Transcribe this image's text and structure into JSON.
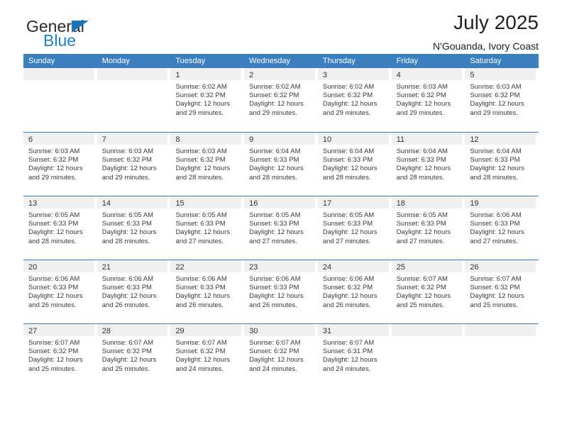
{
  "brand": {
    "name_top": "General",
    "name_bottom": "Blue"
  },
  "header": {
    "title": "July 2025",
    "subtitle": "N'Gouanda, Ivory Coast"
  },
  "calendar": {
    "weekdays": [
      "Sunday",
      "Monday",
      "Tuesday",
      "Wednesday",
      "Thursday",
      "Friday",
      "Saturday"
    ],
    "accent_color": "#3c7fbe",
    "band_color": "#f0f0f0",
    "weeks": [
      [
        {
          "day": "",
          "empty": true
        },
        {
          "day": "",
          "empty": true
        },
        {
          "day": "1",
          "sunrise": "Sunrise: 6:02 AM",
          "sunset": "Sunset: 6:32 PM",
          "daylight1": "Daylight: 12 hours",
          "daylight2": "and 29 minutes."
        },
        {
          "day": "2",
          "sunrise": "Sunrise: 6:02 AM",
          "sunset": "Sunset: 6:32 PM",
          "daylight1": "Daylight: 12 hours",
          "daylight2": "and 29 minutes."
        },
        {
          "day": "3",
          "sunrise": "Sunrise: 6:02 AM",
          "sunset": "Sunset: 6:32 PM",
          "daylight1": "Daylight: 12 hours",
          "daylight2": "and 29 minutes."
        },
        {
          "day": "4",
          "sunrise": "Sunrise: 6:03 AM",
          "sunset": "Sunset: 6:32 PM",
          "daylight1": "Daylight: 12 hours",
          "daylight2": "and 29 minutes."
        },
        {
          "day": "5",
          "sunrise": "Sunrise: 6:03 AM",
          "sunset": "Sunset: 6:32 PM",
          "daylight1": "Daylight: 12 hours",
          "daylight2": "and 29 minutes."
        }
      ],
      [
        {
          "day": "6",
          "sunrise": "Sunrise: 6:03 AM",
          "sunset": "Sunset: 6:32 PM",
          "daylight1": "Daylight: 12 hours",
          "daylight2": "and 29 minutes."
        },
        {
          "day": "7",
          "sunrise": "Sunrise: 6:03 AM",
          "sunset": "Sunset: 6:32 PM",
          "daylight1": "Daylight: 12 hours",
          "daylight2": "and 29 minutes."
        },
        {
          "day": "8",
          "sunrise": "Sunrise: 6:03 AM",
          "sunset": "Sunset: 6:32 PM",
          "daylight1": "Daylight: 12 hours",
          "daylight2": "and 28 minutes."
        },
        {
          "day": "9",
          "sunrise": "Sunrise: 6:04 AM",
          "sunset": "Sunset: 6:33 PM",
          "daylight1": "Daylight: 12 hours",
          "daylight2": "and 28 minutes."
        },
        {
          "day": "10",
          "sunrise": "Sunrise: 6:04 AM",
          "sunset": "Sunset: 6:33 PM",
          "daylight1": "Daylight: 12 hours",
          "daylight2": "and 28 minutes."
        },
        {
          "day": "11",
          "sunrise": "Sunrise: 6:04 AM",
          "sunset": "Sunset: 6:33 PM",
          "daylight1": "Daylight: 12 hours",
          "daylight2": "and 28 minutes."
        },
        {
          "day": "12",
          "sunrise": "Sunrise: 6:04 AM",
          "sunset": "Sunset: 6:33 PM",
          "daylight1": "Daylight: 12 hours",
          "daylight2": "and 28 minutes."
        }
      ],
      [
        {
          "day": "13",
          "sunrise": "Sunrise: 6:05 AM",
          "sunset": "Sunset: 6:33 PM",
          "daylight1": "Daylight: 12 hours",
          "daylight2": "and 28 minutes."
        },
        {
          "day": "14",
          "sunrise": "Sunrise: 6:05 AM",
          "sunset": "Sunset: 6:33 PM",
          "daylight1": "Daylight: 12 hours",
          "daylight2": "and 28 minutes."
        },
        {
          "day": "15",
          "sunrise": "Sunrise: 6:05 AM",
          "sunset": "Sunset: 6:33 PM",
          "daylight1": "Daylight: 12 hours",
          "daylight2": "and 27 minutes."
        },
        {
          "day": "16",
          "sunrise": "Sunrise: 6:05 AM",
          "sunset": "Sunset: 6:33 PM",
          "daylight1": "Daylight: 12 hours",
          "daylight2": "and 27 minutes."
        },
        {
          "day": "17",
          "sunrise": "Sunrise: 6:05 AM",
          "sunset": "Sunset: 6:33 PM",
          "daylight1": "Daylight: 12 hours",
          "daylight2": "and 27 minutes."
        },
        {
          "day": "18",
          "sunrise": "Sunrise: 6:05 AM",
          "sunset": "Sunset: 6:33 PM",
          "daylight1": "Daylight: 12 hours",
          "daylight2": "and 27 minutes."
        },
        {
          "day": "19",
          "sunrise": "Sunrise: 6:06 AM",
          "sunset": "Sunset: 6:33 PM",
          "daylight1": "Daylight: 12 hours",
          "daylight2": "and 27 minutes."
        }
      ],
      [
        {
          "day": "20",
          "sunrise": "Sunrise: 6:06 AM",
          "sunset": "Sunset: 6:33 PM",
          "daylight1": "Daylight: 12 hours",
          "daylight2": "and 26 minutes."
        },
        {
          "day": "21",
          "sunrise": "Sunrise: 6:06 AM",
          "sunset": "Sunset: 6:33 PM",
          "daylight1": "Daylight: 12 hours",
          "daylight2": "and 26 minutes."
        },
        {
          "day": "22",
          "sunrise": "Sunrise: 6:06 AM",
          "sunset": "Sunset: 6:33 PM",
          "daylight1": "Daylight: 12 hours",
          "daylight2": "and 26 minutes."
        },
        {
          "day": "23",
          "sunrise": "Sunrise: 6:06 AM",
          "sunset": "Sunset: 6:33 PM",
          "daylight1": "Daylight: 12 hours",
          "daylight2": "and 26 minutes."
        },
        {
          "day": "24",
          "sunrise": "Sunrise: 6:06 AM",
          "sunset": "Sunset: 6:32 PM",
          "daylight1": "Daylight: 12 hours",
          "daylight2": "and 26 minutes."
        },
        {
          "day": "25",
          "sunrise": "Sunrise: 6:07 AM",
          "sunset": "Sunset: 6:32 PM",
          "daylight1": "Daylight: 12 hours",
          "daylight2": "and 25 minutes."
        },
        {
          "day": "26",
          "sunrise": "Sunrise: 6:07 AM",
          "sunset": "Sunset: 6:32 PM",
          "daylight1": "Daylight: 12 hours",
          "daylight2": "and 25 minutes."
        }
      ],
      [
        {
          "day": "27",
          "sunrise": "Sunrise: 6:07 AM",
          "sunset": "Sunset: 6:32 PM",
          "daylight1": "Daylight: 12 hours",
          "daylight2": "and 25 minutes."
        },
        {
          "day": "28",
          "sunrise": "Sunrise: 6:07 AM",
          "sunset": "Sunset: 6:32 PM",
          "daylight1": "Daylight: 12 hours",
          "daylight2": "and 25 minutes."
        },
        {
          "day": "29",
          "sunrise": "Sunrise: 6:07 AM",
          "sunset": "Sunset: 6:32 PM",
          "daylight1": "Daylight: 12 hours",
          "daylight2": "and 24 minutes."
        },
        {
          "day": "30",
          "sunrise": "Sunrise: 6:07 AM",
          "sunset": "Sunset: 6:32 PM",
          "daylight1": "Daylight: 12 hours",
          "daylight2": "and 24 minutes."
        },
        {
          "day": "31",
          "sunrise": "Sunrise: 6:07 AM",
          "sunset": "Sunset: 6:31 PM",
          "daylight1": "Daylight: 12 hours",
          "daylight2": "and 24 minutes."
        },
        {
          "day": "",
          "empty": true
        },
        {
          "day": "",
          "empty": true
        }
      ]
    ]
  }
}
